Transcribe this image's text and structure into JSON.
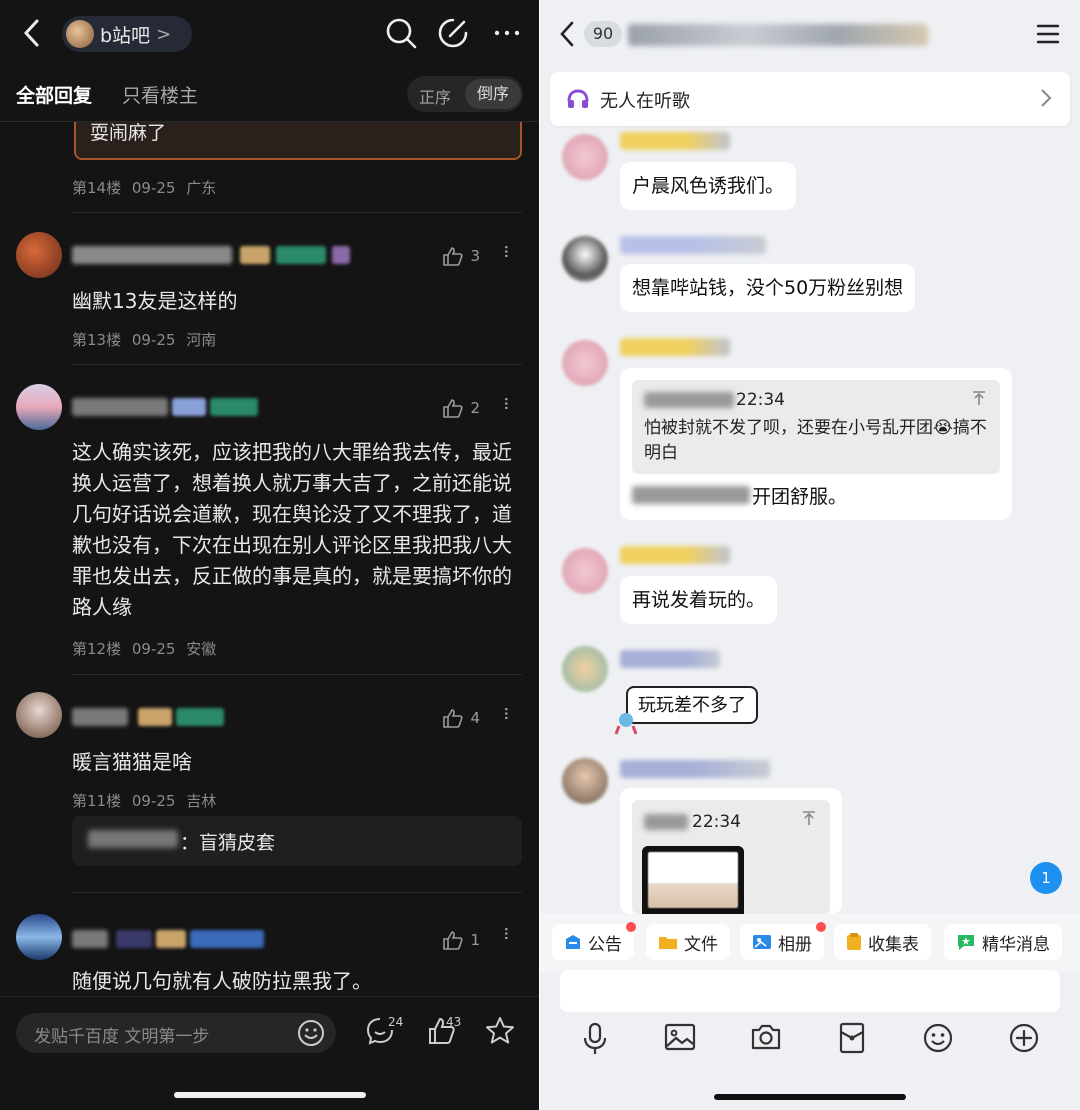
{
  "left": {
    "forum_name": "b站吧",
    "forum_chevron": ">",
    "tabs": {
      "all": "全部回复",
      "op_only": "只看楼主"
    },
    "sort": {
      "asc": "正序",
      "desc": "倒序"
    },
    "quoted_tail": "耍闹麻了",
    "floor14_meta": "第14楼 09-25 广东",
    "floors": [
      {
        "likes": "3",
        "text": "幽默13友是这样的",
        "meta": "第13楼 09-25 河南"
      },
      {
        "likes": "2",
        "text": "这人确实该死，应该把我的八大罪给我去传，最近换人运营了，想着换人就万事大吉了，之前还能说几句好话说会道歉，现在舆论没了又不理我了，道歉也没有，下次在出现在别人评论区里我把我八大罪也发出去，反正做的事是真的，就是要搞坏你的路人缘",
        "meta": "第12楼 09-25 安徽"
      },
      {
        "likes": "4",
        "text": "暖言猫猫是啥",
        "meta": "第11楼 09-25 吉林",
        "sub_reply": "：盲猜皮套"
      },
      {
        "likes": "1",
        "text": "随便说几句就有人破防拉黑我了。"
      }
    ],
    "bottom": {
      "input_placeholder": "发贴千百度 文明第一步",
      "comment_count": "24",
      "like_count": "43"
    },
    "colors": {
      "bg": "#141414",
      "quote_border": "#a8562a"
    }
  },
  "right": {
    "unread_count": "90",
    "music_bar": "无人在听歌",
    "messages": [
      {
        "text": "户晨风色诱我们。"
      },
      {
        "text": "想靠哔站钱，没个50万粉丝别想"
      },
      {
        "reply_time": "22:34",
        "reply_text": "怕被封就不发了呗，还要在小号乱开团😭搞不明白",
        "text": "开团舒服。"
      },
      {
        "text": "再说发着玩的。"
      },
      {
        "text": "玩玩差不多了"
      },
      {
        "reply_time": "22:34"
      }
    ],
    "float_badge": "1",
    "quick_actions": [
      "公告",
      "文件",
      "相册",
      "收集表",
      "精华消息"
    ],
    "colors": {
      "bg": "#eef0f3",
      "accent": "#1e90f0",
      "alert_dot": "#ff4d4f"
    }
  }
}
